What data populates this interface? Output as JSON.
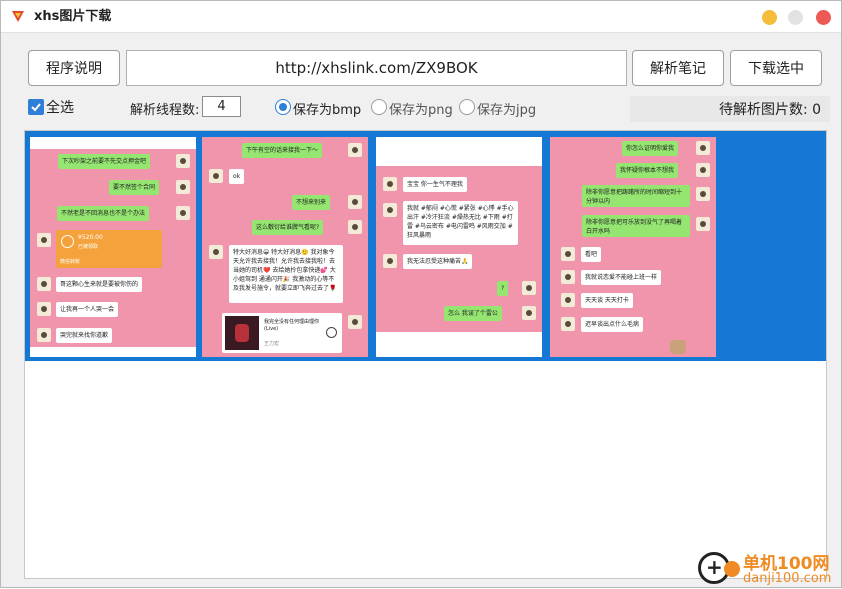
{
  "window": {
    "title": "xhs图片下载",
    "icon": "app-logo-icon",
    "controls": {
      "minimize_color": "#f5bd3a",
      "maximize_color": "#e2e2e2",
      "close_color": "#ed5a55"
    }
  },
  "toolbar": {
    "info_label": "程序说明",
    "url_value": "http://xhslink.com/ZX9BOK",
    "parse_label": "解析笔记",
    "download_label": "下载选中"
  },
  "options": {
    "select_all_label": "全选",
    "select_all_checked": true,
    "threads_label": "解析线程数:",
    "threads_value": "4",
    "formats": [
      {
        "label": "保存为bmp",
        "selected": true
      },
      {
        "label": "保存为png",
        "selected": false
      },
      {
        "label": "保存为jpg",
        "selected": false
      }
    ],
    "pending_label": "待解析图片数:",
    "pending_count": "0"
  },
  "gallery": {
    "selection_color": "#1478d4",
    "thumbs": [
      {
        "bubbles": [
          {
            "text": "下次吵架之前要不先交点押金吧",
            "side": "right"
          },
          {
            "text": "要不然签个合同",
            "side": "right"
          },
          {
            "text": "不然老是不回消息也不是个办法",
            "side": "right"
          },
          {
            "card_amount": "¥520.00",
            "card_sub": "已被领取",
            "card_foot": "微信转账"
          },
          {
            "text": "哥这颗心生来就是要被你伤的",
            "side": "left"
          },
          {
            "text": "让我再一个人哭一会",
            "side": "left"
          },
          {
            "text": "哭完就来找你道歉",
            "side": "left"
          }
        ]
      },
      {
        "bubbles": [
          {
            "text": "下午有空的话来接我一下～",
            "side": "right"
          },
          {
            "text": "ok",
            "side": "left"
          },
          {
            "text": "不想来别来",
            "side": "right"
          },
          {
            "text": "这么敷衍给谁脾气看呢?",
            "side": "right"
          },
          {
            "text": "特大好消息😀 特大好消息🙂 我对象今天允许我去接我！允许我去接我啦！去当她的司机❤️ 去给她拎包拿快递💕 大小姐驾到 通通闪开🎉 我激动的心等不及我发号施令，就要立即飞奔过去了🌹",
            "side": "left"
          },
          {
            "music_title": "我完全没有任何理由理你 (Live)",
            "music_artist": "王力宏"
          }
        ]
      },
      {
        "bubbles": [
          {
            "text": "宝宝 你一生气不理我",
            "side": "left"
          },
          {
            "text": "我就 #郁闷 #心慌 #紧张 #心悸 #手心出汗 #冷汗狂流 #燥热无比 #下雨 #打雷 #乌云密布 #电闪雷鸣 #风雨交加 #狂风暴雨",
            "side": "left"
          },
          {
            "text": "我无法忍受这种痛苦🙏",
            "side": "left"
          },
          {
            "text": "?",
            "side": "right"
          },
          {
            "text": "怎么 我误了个雷公",
            "side": "right"
          }
        ]
      },
      {
        "bubbles": [
          {
            "text": "你怎么证明你爱我",
            "side": "right"
          },
          {
            "text": "我怀疑你根本不想我",
            "side": "right"
          },
          {
            "text": "除非你愿意把踌躇所的时间缩短到十分钟以内",
            "side": "right"
          },
          {
            "text": "除非你愿意把可乐放到没气了再喝着白开水吗",
            "side": "right"
          },
          {
            "text": "看吧",
            "side": "left"
          },
          {
            "text": "我就说恋爱不能碰上班一样",
            "side": "left"
          },
          {
            "text": "天天谈 天天打卡",
            "side": "left"
          },
          {
            "text": "迟早谈出点什么毛病",
            "side": "left"
          }
        ]
      }
    ]
  },
  "watermark": {
    "brand_cn": "单机100网",
    "brand_en": "danji100.com"
  }
}
